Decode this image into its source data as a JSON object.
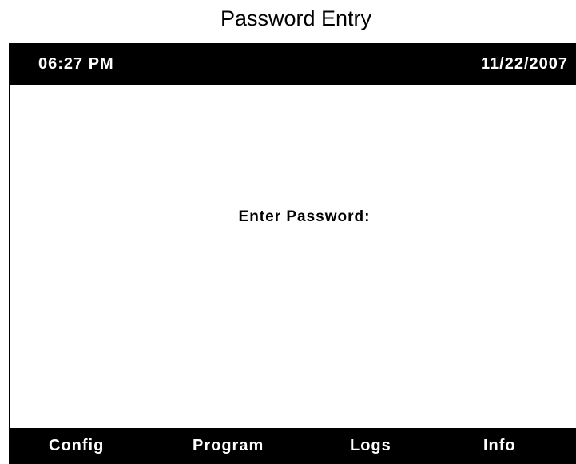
{
  "title": "Password Entry",
  "status_bar": {
    "time": "06:27 PM",
    "date": "11/22/2007"
  },
  "main": {
    "prompt": "Enter Password:"
  },
  "softkeys": [
    {
      "label": "Config"
    },
    {
      "label": "Program"
    },
    {
      "label": "Logs"
    },
    {
      "label": "Info"
    }
  ],
  "colors": {
    "bar_background": "#000000",
    "bar_text": "#ffffff",
    "screen_background": "#ffffff"
  }
}
